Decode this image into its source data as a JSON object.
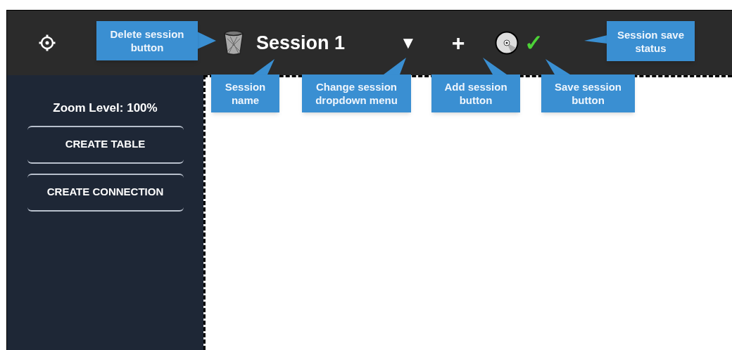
{
  "toolbar": {
    "session_name": "Session 1",
    "dropdown_glyph": "▼",
    "add_glyph": "+",
    "save_status": "✓"
  },
  "sidebar": {
    "zoom_label": "Zoom Level: 100%",
    "buttons": [
      "CREATE TABLE",
      "CREATE CONNECTION"
    ]
  },
  "callouts": [
    {
      "text": "Delete session button"
    },
    {
      "text": "Session name"
    },
    {
      "text": "Change session dropdown menu"
    },
    {
      "text": "Add session button"
    },
    {
      "text": "Save session button"
    },
    {
      "text": "Session save status"
    }
  ]
}
